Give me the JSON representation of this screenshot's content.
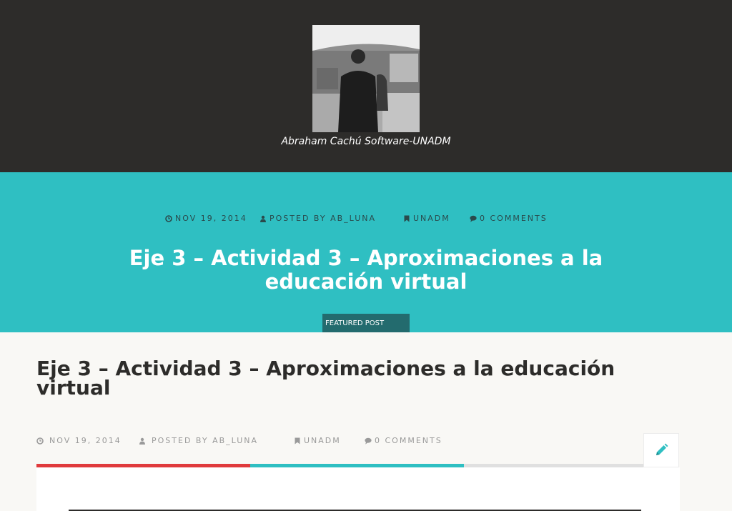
{
  "header": {
    "site_title": "Abraham Cachú Software-UNADM",
    "avatar_alt": "Abraham Cachú"
  },
  "hero": {
    "meta": {
      "date": "NOV 19, 2014",
      "author": "POSTED BY AB_LUNA",
      "category": "UNADM",
      "comments": "0 COMMENTS"
    },
    "title": "Eje 3 – Actividad 3 – Aproximaciones a la educación virtual",
    "badge": "FEATURED POST"
  },
  "post": {
    "title": "Eje 3 – Actividad 3 – Aproximaciones a la educación virtual",
    "meta": {
      "date": "NOV 19, 2014",
      "author": "POSTED BY AB_LUNA",
      "category": "UNADM",
      "comments": "0 COMMENTS"
    }
  },
  "icons": {
    "date": "clock-icon",
    "author": "user-icon",
    "category": "bookmark-icon",
    "comments": "comments-icon",
    "edit": "pencil-icon"
  },
  "colors": {
    "header_bg": "#2d2c2a",
    "hero_bg": "#2fbfc2",
    "badge_bg": "#236b6e",
    "bar_red": "#e03a3c",
    "bar_teal": "#2fbfc2",
    "bar_grey": "#e0e0e0",
    "page_bg": "#f9f8f5"
  }
}
